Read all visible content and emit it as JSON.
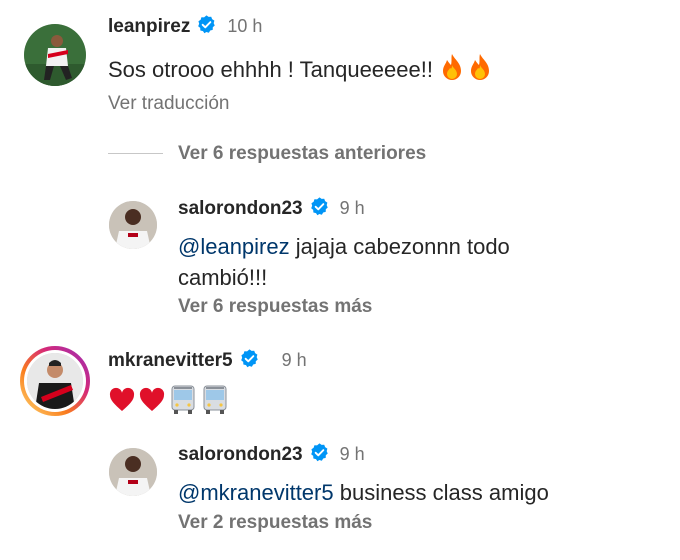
{
  "comments": [
    {
      "username": "leanpirez",
      "time": "10 h",
      "text": "Sos otrooo ehhhh ! Tanqueeeee!!",
      "emoji": [
        "fire-emoji",
        "fire-emoji"
      ],
      "translate_label": "Ver traducción",
      "replies_label": "Ver 6 respuestas anteriores",
      "reply": {
        "username": "salorondon23",
        "time": "9 h",
        "mention": "@leanpirez",
        "text_line1": " jajaja cabezonnn todo",
        "text_line2": "cambió!!!",
        "more_label": "Ver 6 respuestas más"
      }
    },
    {
      "username": "mkranevitter5",
      "time": "9 h",
      "emoji": [
        "heart-emoji",
        "heart-emoji",
        "bus-emoji",
        "bus-emoji"
      ],
      "reply": {
        "username": "salorondon23",
        "time": "9 h",
        "mention": "@mkranevitter5",
        "text": " business class amigo",
        "more_label": "Ver 2 respuestas más"
      }
    }
  ],
  "colors": {
    "verified": "#0095f6",
    "mention": "#00376b",
    "secondary_text": "#737373"
  }
}
